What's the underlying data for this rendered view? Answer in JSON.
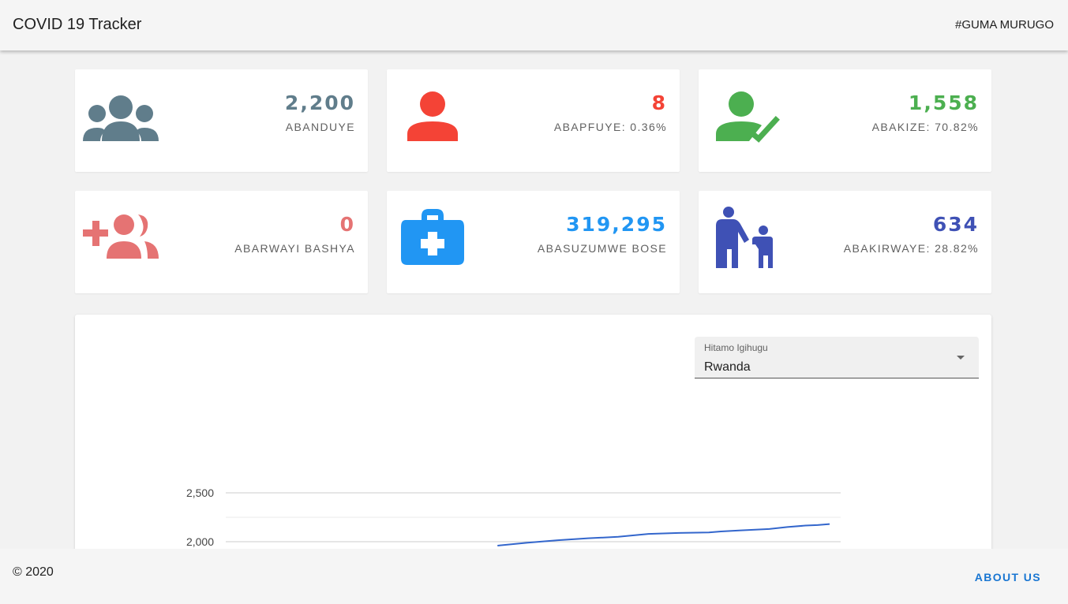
{
  "header": {
    "title": "COVID 19 Tracker",
    "hashtag": "#GUMA MURUGO"
  },
  "stats": [
    {
      "value": "2,200",
      "label": "ABANDUYE",
      "color": "#607d8b",
      "icon": "group-icon"
    },
    {
      "value": "8",
      "label": "ABAPFUYE: 0.36%",
      "color": "#f44336",
      "icon": "person-icon"
    },
    {
      "value": "1,558",
      "label": "ABAKIZE: 70.82%",
      "color": "#4caf50",
      "icon": "person-check-icon"
    },
    {
      "value": "0",
      "label": "ABARWAYI BASHYA",
      "color": "#e57373",
      "icon": "group-add-icon"
    },
    {
      "value": "319,295",
      "label": "ABASUZUMWE BOSE",
      "color": "#2196f3",
      "icon": "medical-bag-icon"
    },
    {
      "value": "634",
      "label": "ABAKIRWAYE: 28.82%",
      "color": "#3f51b5",
      "icon": "parent-child-icon"
    }
  ],
  "country_select": {
    "label": "Hitamo Igihugu",
    "value": "Rwanda"
  },
  "chart_data": {
    "type": "line",
    "y_ticks": [
      "2,500",
      "2,000"
    ],
    "ylim": [
      2000,
      2500
    ],
    "line_color": "#3366cc",
    "series": [
      {
        "points": [
          [
            0.45,
            1960
          ],
          [
            0.5,
            1990
          ],
          [
            0.55,
            2015
          ],
          [
            0.6,
            2035
          ],
          [
            0.65,
            2050
          ],
          [
            0.7,
            2080
          ],
          [
            0.75,
            2090
          ],
          [
            0.8,
            2095
          ],
          [
            0.82,
            2105
          ],
          [
            0.85,
            2115
          ],
          [
            0.9,
            2130
          ],
          [
            0.93,
            2150
          ],
          [
            0.96,
            2165
          ],
          [
            0.98,
            2170
          ],
          [
            1.0,
            2180
          ]
        ]
      }
    ]
  },
  "footer": {
    "copyright": "© 2020",
    "about": "ABOUT US"
  }
}
